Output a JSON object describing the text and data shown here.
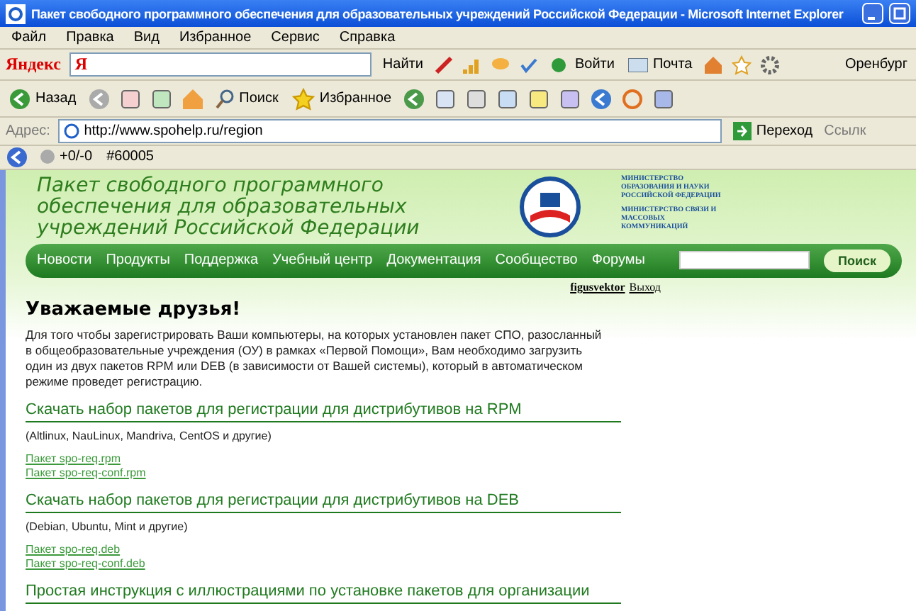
{
  "window": {
    "title": "Пакет свободного программного обеспечения для образовательных учреждений Российской Федерации - Microsoft Internet Explorer"
  },
  "menu": [
    "Файл",
    "Правка",
    "Вид",
    "Избранное",
    "Сервис",
    "Справка"
  ],
  "yandex_bar": {
    "logo": "Яндекс",
    "field_logo": "Я",
    "search_button": "Найти",
    "login": "Войти",
    "mail": "Почта",
    "city": "Оренбург"
  },
  "toolbar": {
    "back": "Назад",
    "search": "Поиск",
    "favorites": "Избранное"
  },
  "address_bar": {
    "label": "Адрес:",
    "url": "http://www.spohelp.ru/region",
    "go": "Переход",
    "links": "Ссылк"
  },
  "extra_bar": {
    "counter": "+0/-0",
    "id": "#60005"
  },
  "site": {
    "title": "Пакет свободного программного обеспечения для образовательных учреждений Российской Федерации",
    "ministries": [
      "МИНИСТЕРСТВО ОБРАЗОВАНИЯ И НАУКИ РОССИЙСКОЙ ФЕДЕРАЦИИ",
      "МИНИСТЕРСТВО СВЯЗИ И МАССОВЫХ КОММУНИКАЦИЙ"
    ],
    "nav": [
      "Новости",
      "Продукты",
      "Поддержка",
      "Учебный центр",
      "Документация",
      "Сообщество",
      "Форумы"
    ],
    "search_button": "Поиск",
    "user": "figusvektor",
    "logout": "Выход"
  },
  "content": {
    "heading": "Уважаемые друзья!",
    "paragraph": "Для того чтобы зарегистрировать Ваши компьютеры, на которых установлен пакет СПО, разосланный в общеобразовательные учреждения (ОУ) в рамках «Первой Помощи», Вам необходимо загрузить один из двух пакетов RPM или DEB (в зависимости от Вашей системы), который в автоматическом режиме проведет регистрацию.",
    "sections": [
      {
        "title": "Скачать набор пакетов для регистрации для дистрибутивов на RPM",
        "note": "(Altlinux, NauLinux, Mandriva, CentOS и другие)",
        "links": [
          "Пакет spo-req.rpm",
          "Пакет spo-req-conf.rpm"
        ]
      },
      {
        "title": "Скачать набор пакетов для регистрации для дистрибутивов на DEB",
        "note": "(Debian, Ubuntu, Mint и другие)",
        "links": [
          "Пакет spo-req.deb",
          "Пакет spo-req-conf.deb"
        ]
      },
      {
        "title": "Простая инструкция с иллюстрациями по установке пакетов для организации"
      }
    ]
  }
}
